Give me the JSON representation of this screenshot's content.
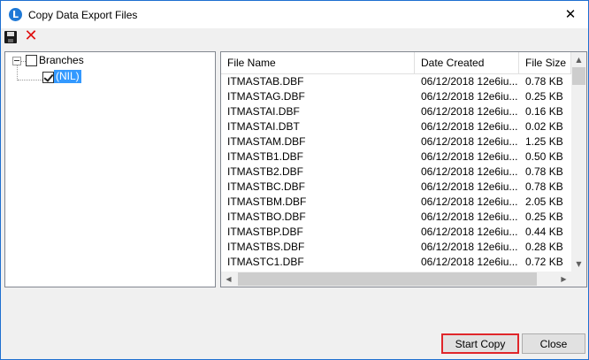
{
  "window": {
    "title": "Copy Data Export Files",
    "close_glyph": "✕",
    "app_icon": "app-logo-icon",
    "app_icon_glyph": "L"
  },
  "toolbar": {
    "save_icon": "floppy-disk-icon",
    "delete_icon": "delete-x-icon",
    "delete_glyph": "✕"
  },
  "tree": {
    "root": {
      "label": "Branches",
      "checked": false,
      "expanded": true
    },
    "children": [
      {
        "label": "(NIL)",
        "checked": true,
        "selected": true
      }
    ]
  },
  "file_list": {
    "columns": [
      "File Name",
      "Date Created",
      "File Size"
    ],
    "rows": [
      [
        "ITMASTAB.DBF",
        "06/12/2018 12e6iu...",
        "0.78 KB"
      ],
      [
        "ITMASTAG.DBF",
        "06/12/2018 12e6iu...",
        "0.25 KB"
      ],
      [
        "ITMASTAI.DBF",
        "06/12/2018 12e6iu...",
        "0.16 KB"
      ],
      [
        "ITMASTAI.DBT",
        "06/12/2018 12e6iu...",
        "0.02 KB"
      ],
      [
        "ITMASTAM.DBF",
        "06/12/2018 12e6iu...",
        "1.25 KB"
      ],
      [
        "ITMASTB1.DBF",
        "06/12/2018 12e6iu...",
        "0.50 KB"
      ],
      [
        "ITMASTB2.DBF",
        "06/12/2018 12e6iu...",
        "0.78 KB"
      ],
      [
        "ITMASTBC.DBF",
        "06/12/2018 12e6iu...",
        "0.78 KB"
      ],
      [
        "ITMASTBM.DBF",
        "06/12/2018 12e6iu...",
        "2.05 KB"
      ],
      [
        "ITMASTBO.DBF",
        "06/12/2018 12e6iu...",
        "0.25 KB"
      ],
      [
        "ITMASTBP.DBF",
        "06/12/2018 12e6iu...",
        "0.44 KB"
      ],
      [
        "ITMASTBS.DBF",
        "06/12/2018 12e6iu...",
        "0.28 KB"
      ],
      [
        "ITMASTC1.DBF",
        "06/12/2018 12e6iu...",
        "0.72 KB"
      ]
    ]
  },
  "scrollbars": {
    "up_glyph": "▲",
    "down_glyph": "▼",
    "left_glyph": "◀",
    "right_glyph": "▶"
  },
  "buttons": {
    "start_copy": "Start Copy",
    "close": "Close",
    "highlight_color": "#e0262b"
  },
  "colors": {
    "selection": "#3399ff",
    "window_border": "#1e6fd0"
  }
}
